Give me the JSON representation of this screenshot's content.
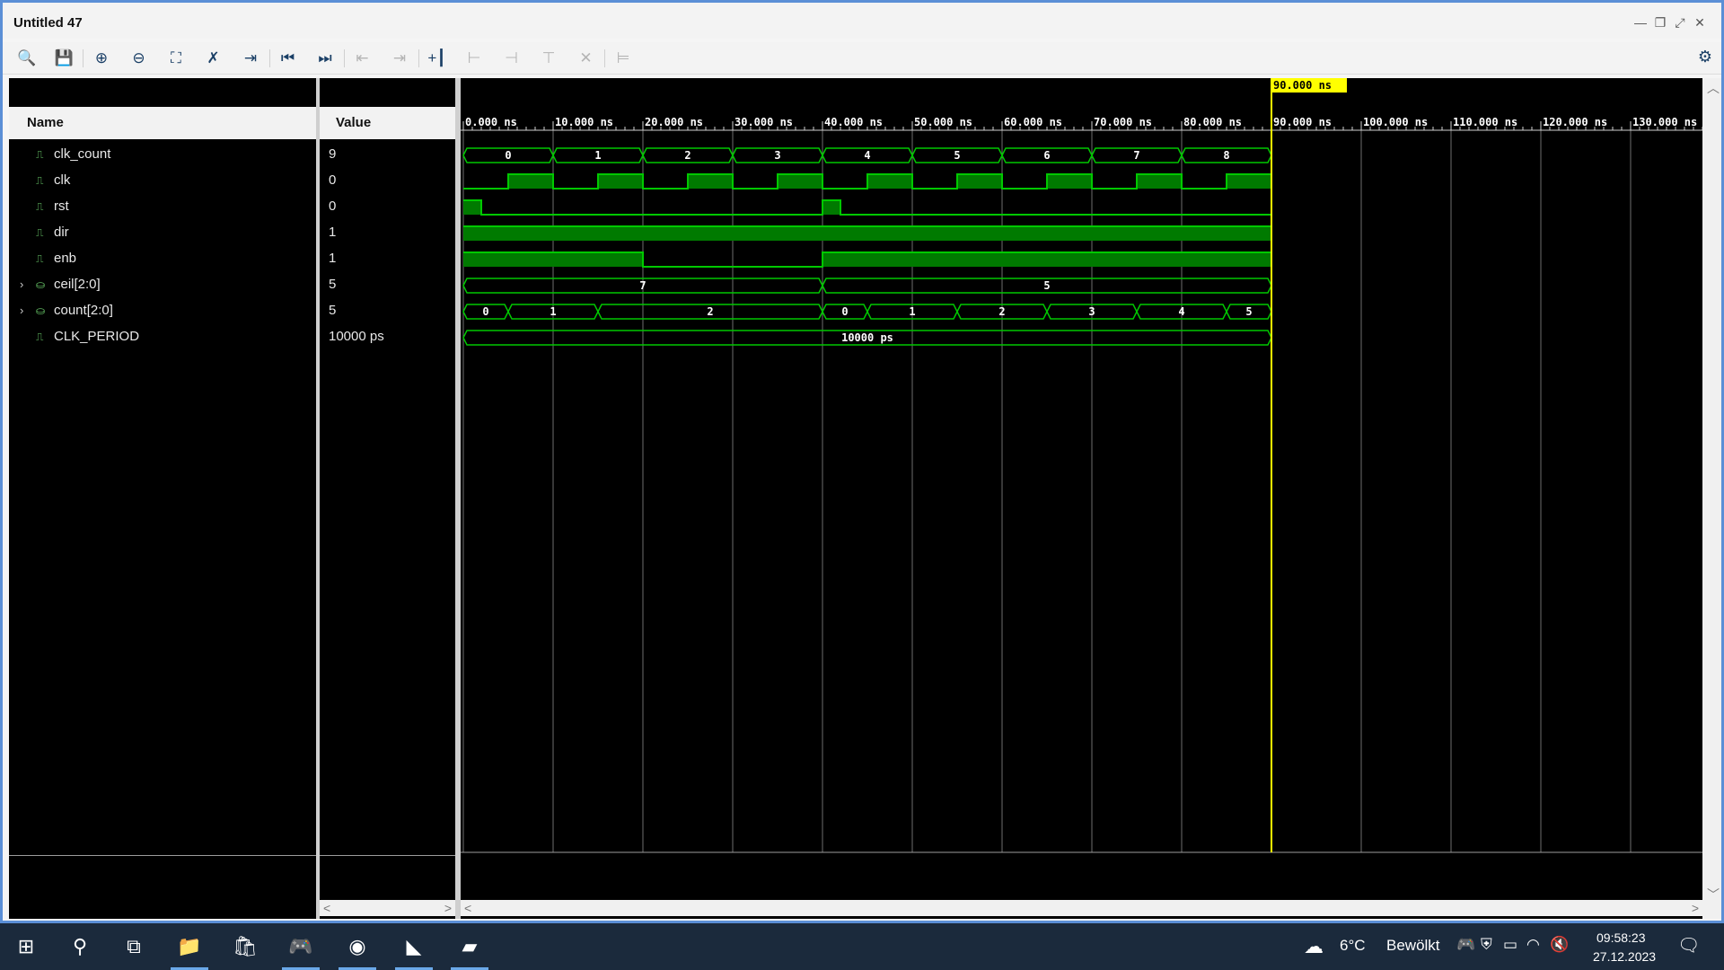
{
  "window": {
    "title": "Untitled 47"
  },
  "window_controls": [
    "—",
    "❐",
    "⤢",
    "✕"
  ],
  "toolbar": [
    {
      "icon": "search-icon",
      "glyph": "🔍",
      "enabled": true
    },
    {
      "icon": "save-icon",
      "glyph": "💾",
      "enabled": true
    },
    {
      "icon": "zoom-in-icon",
      "glyph": "⊕",
      "enabled": true
    },
    {
      "icon": "zoom-out-icon",
      "glyph": "⊖",
      "enabled": true
    },
    {
      "icon": "zoom-fit-icon",
      "glyph": "⛶",
      "enabled": true
    },
    {
      "icon": "cursor-icon",
      "glyph": "✗",
      "enabled": true
    },
    {
      "icon": "go-to-cursor-icon",
      "glyph": "⇥",
      "enabled": true
    },
    {
      "icon": "go-to-start-icon",
      "glyph": "⏮",
      "enabled": true
    },
    {
      "icon": "go-to-end-icon",
      "glyph": "⏭",
      "enabled": true
    },
    {
      "icon": "prev-transition-icon",
      "glyph": "⇤",
      "enabled": false
    },
    {
      "icon": "next-transition-icon",
      "glyph": "⇥",
      "enabled": false
    },
    {
      "icon": "add-marker-icon",
      "glyph": "+┃",
      "enabled": true
    },
    {
      "icon": "prev-marker-icon",
      "glyph": "⊢",
      "enabled": false
    },
    {
      "icon": "next-marker-icon",
      "glyph": "⊣",
      "enabled": false
    },
    {
      "icon": "swap-cursors-icon",
      "glyph": "⊤",
      "enabled": false
    },
    {
      "icon": "delete-icon",
      "glyph": "✕",
      "enabled": false
    },
    {
      "icon": "snap-icon",
      "glyph": "⊨",
      "enabled": false
    }
  ],
  "panes": {
    "name_header": "Name",
    "value_header": "Value"
  },
  "signals": [
    {
      "name": "clk_count",
      "value": "9",
      "kind": "scalar",
      "expandable": false
    },
    {
      "name": "clk",
      "value": "0",
      "kind": "scalar",
      "expandable": false
    },
    {
      "name": "rst",
      "value": "0",
      "kind": "scalar",
      "expandable": false
    },
    {
      "name": "dir",
      "value": "1",
      "kind": "scalar",
      "expandable": false
    },
    {
      "name": "enb",
      "value": "1",
      "kind": "scalar",
      "expandable": false
    },
    {
      "name": "ceil[2:0]",
      "value": "5",
      "kind": "bus",
      "expandable": true
    },
    {
      "name": "count[2:0]",
      "value": "5",
      "kind": "bus",
      "expandable": true
    },
    {
      "name": "CLK_PERIOD",
      "value": "10000 ps",
      "kind": "param",
      "expandable": false
    }
  ],
  "waveform": {
    "cursor_label": "90.000 ns",
    "cursor_time_ns": 90,
    "time_range_ns": [
      0,
      138
    ],
    "tick_labels": [
      "0.000 ns",
      "10.000 ns",
      "20.000 ns",
      "30.000 ns",
      "40.000 ns",
      "50.000 ns",
      "60.000 ns",
      "70.000 ns",
      "80.000 ns",
      "90.000 ns",
      "100.000 ns",
      "110.000 ns",
      "120.000 ns",
      "130.000 ns"
    ],
    "sim_end_ns": 90,
    "colors": {
      "trace": "#00c800",
      "fill": "#007a00",
      "cursor": "#ffff00",
      "grid": "#6e6e6e",
      "text": "#ffffff"
    },
    "traces": [
      {
        "type": "bus",
        "segments": [
          [
            0,
            10,
            "0"
          ],
          [
            10,
            20,
            "1"
          ],
          [
            20,
            30,
            "2"
          ],
          [
            30,
            40,
            "3"
          ],
          [
            40,
            50,
            "4"
          ],
          [
            50,
            60,
            "5"
          ],
          [
            60,
            70,
            "6"
          ],
          [
            70,
            80,
            "7"
          ],
          [
            80,
            90,
            "8"
          ]
        ]
      },
      {
        "type": "bit",
        "transitions": [
          [
            0,
            0
          ],
          [
            5,
            1
          ],
          [
            10,
            0
          ],
          [
            15,
            1
          ],
          [
            20,
            0
          ],
          [
            25,
            1
          ],
          [
            30,
            0
          ],
          [
            35,
            1
          ],
          [
            40,
            0
          ],
          [
            45,
            1
          ],
          [
            50,
            0
          ],
          [
            55,
            1
          ],
          [
            60,
            0
          ],
          [
            65,
            1
          ],
          [
            70,
            0
          ],
          [
            75,
            1
          ],
          [
            80,
            0
          ],
          [
            85,
            1
          ]
        ]
      },
      {
        "type": "bit",
        "transitions": [
          [
            0,
            1
          ],
          [
            2,
            0
          ],
          [
            40,
            1
          ],
          [
            42,
            0
          ]
        ]
      },
      {
        "type": "bit",
        "transitions": [
          [
            0,
            1
          ]
        ]
      },
      {
        "type": "bit",
        "transitions": [
          [
            0,
            1
          ],
          [
            20,
            0
          ],
          [
            40,
            1
          ]
        ]
      },
      {
        "type": "bus",
        "segments": [
          [
            0,
            40,
            "7"
          ],
          [
            40,
            90,
            "5"
          ]
        ]
      },
      {
        "type": "bus",
        "segments": [
          [
            0,
            5,
            "0"
          ],
          [
            5,
            15,
            "1"
          ],
          [
            15,
            40,
            "2"
          ],
          [
            40,
            45,
            "0"
          ],
          [
            45,
            55,
            "1"
          ],
          [
            55,
            65,
            "2"
          ],
          [
            65,
            75,
            "3"
          ],
          [
            75,
            85,
            "4"
          ],
          [
            85,
            90,
            "5"
          ]
        ]
      },
      {
        "type": "bus",
        "segments": [
          [
            0,
            90,
            "10000 ps"
          ]
        ]
      }
    ]
  },
  "taskbar": {
    "apps": [
      {
        "icon": "windows-start-icon",
        "glyph": "⊞",
        "active": false
      },
      {
        "icon": "search-icon",
        "glyph": "⚲",
        "active": false
      },
      {
        "icon": "task-view-icon",
        "glyph": "⧉",
        "active": false
      },
      {
        "icon": "file-explorer-icon",
        "glyph": "📁",
        "active": true
      },
      {
        "icon": "microsoft-store-icon",
        "glyph": "🛍",
        "active": false
      },
      {
        "icon": "discord-icon",
        "glyph": "🎮",
        "active": true
      },
      {
        "icon": "chrome-icon",
        "glyph": "◉",
        "active": true
      },
      {
        "icon": "amd-vivado-icon",
        "glyph": "◣",
        "active": true
      },
      {
        "icon": "document-viewer-icon",
        "glyph": "▰",
        "active": true
      }
    ],
    "weather": {
      "temp": "6°C",
      "desc": "Bewölkt"
    },
    "tray_icons": [
      "discord-tray-icon",
      "security-icon",
      "battery-icon",
      "wifi-icon",
      "volume-muted-icon"
    ],
    "clock": {
      "time": "09:58:23",
      "date": "27.12.2023"
    }
  }
}
